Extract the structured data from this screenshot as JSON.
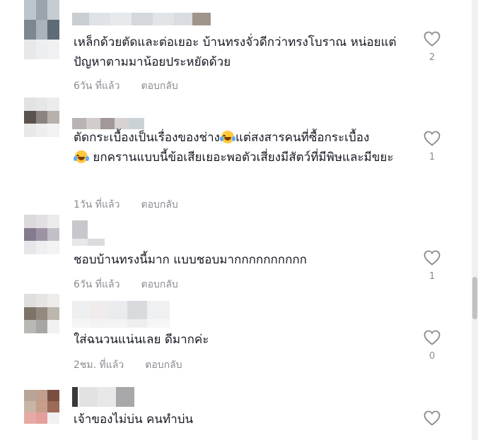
{
  "comments": [
    {
      "text": "เหล็กด้วยตัดและต่อเยอะ บ้านทรงจั่วดีกว่าทรงโบราณ หน่อยแต่ปัญหาตามมาน้อยประหยัดด้วย",
      "time": "6วัน ที่แล้ว",
      "reply": "ตอบกลับ",
      "likes": "2"
    },
    {
      "text_part1": "ตัดกระเบื้องเป็นเรื่องของช่าง",
      "text_part2": "แต่สงสารคนที่ซื้อกระเบื้อง",
      "text_part3": "ยกครานแบบนี้ข้อเสียเยอะพอตัวเสี่ยงมีสัตว์ที่มีพิษและมีขยะ",
      "emoji": "laughing-tears-emoji",
      "time": "1วัน ที่แล้ว",
      "reply": "ตอบกลับ",
      "likes": "1"
    },
    {
      "text": "ชอบบ้านทรงนี้มาก แบบชอบมากกกกกกกกกก",
      "time": "6วัน ที่แล้ว",
      "reply": "ตอบกลับ",
      "likes": "1"
    },
    {
      "text": "ใส่ฉนวนแน่นเลย ดีมากค่ะ",
      "time": "2ชม. ที่แล้ว",
      "reply": "ตอบกลับ",
      "likes": "0"
    },
    {
      "text": "เจ้าของไม่บ่น คนทำบ่น",
      "likes": ""
    }
  ],
  "icons": {
    "like": "heart-outline-icon"
  },
  "colors": {
    "text": "#161823",
    "meta": "#8a8b91"
  }
}
